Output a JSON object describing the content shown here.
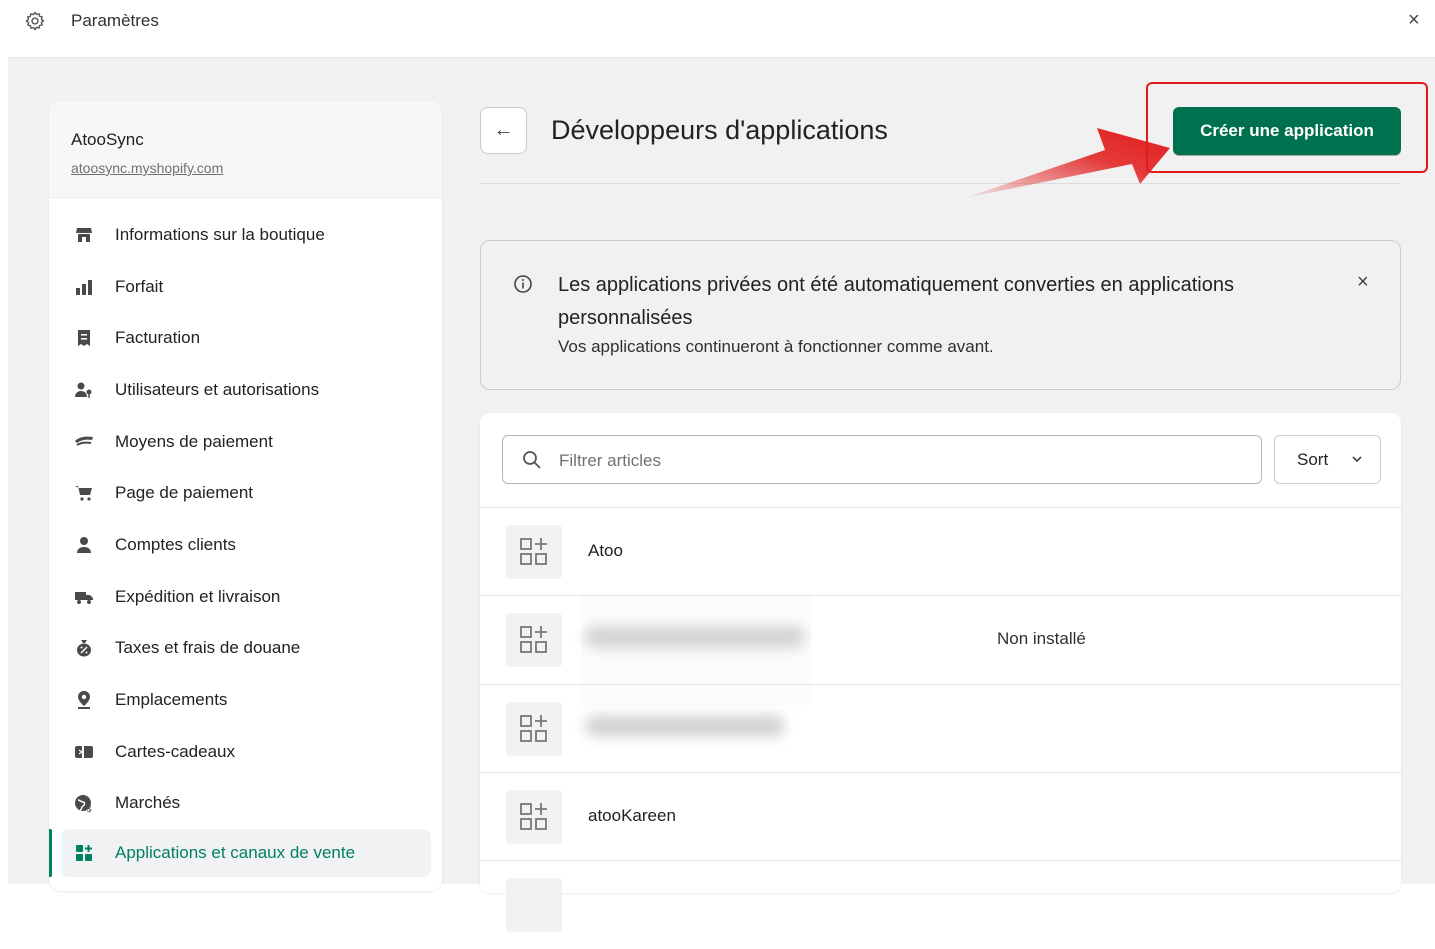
{
  "topbar": {
    "title": "Paramètres",
    "close_label": "×"
  },
  "store": {
    "name": "AtooSync",
    "url": "atoosync.myshopify.com"
  },
  "sidebar": {
    "items": [
      {
        "label": "Informations sur la boutique",
        "icon": "store-icon"
      },
      {
        "label": "Forfait",
        "icon": "plan-icon"
      },
      {
        "label": "Facturation",
        "icon": "receipt-icon"
      },
      {
        "label": "Utilisateurs et autorisations",
        "icon": "users-icon"
      },
      {
        "label": "Moyens de paiement",
        "icon": "payment-icon"
      },
      {
        "label": "Page de paiement",
        "icon": "cart-icon"
      },
      {
        "label": "Comptes clients",
        "icon": "person-icon"
      },
      {
        "label": "Expédition et livraison",
        "icon": "truck-icon"
      },
      {
        "label": "Taxes et frais de douane",
        "icon": "tax-icon"
      },
      {
        "label": "Emplacements",
        "icon": "location-icon"
      },
      {
        "label": "Cartes-cadeaux",
        "icon": "gift-card-icon"
      },
      {
        "label": "Marchés",
        "icon": "globe-icon"
      },
      {
        "label": "Applications et canaux de vente",
        "icon": "apps-icon"
      }
    ],
    "active_index": 12
  },
  "page": {
    "title": "Développeurs d'applications",
    "back_label": "←",
    "create_button": "Créer une application"
  },
  "banner": {
    "title": "Les applications privées ont été automatiquement converties en applications personnalisées",
    "subtitle": "Vos applications continueront à fonctionner comme avant.",
    "close_label": "×"
  },
  "list": {
    "filter_placeholder": "Filtrer articles",
    "sort_label": "Sort",
    "apps": [
      {
        "name": "Atoo",
        "status": ""
      },
      {
        "name": "",
        "status": "Non installé",
        "redacted": true
      },
      {
        "name": "",
        "status": "",
        "redacted": true
      },
      {
        "name": "atooKareen",
        "status": ""
      }
    ]
  },
  "colors": {
    "accent": "#008060",
    "button": "#00714f",
    "annotation": "#e21b1b"
  }
}
